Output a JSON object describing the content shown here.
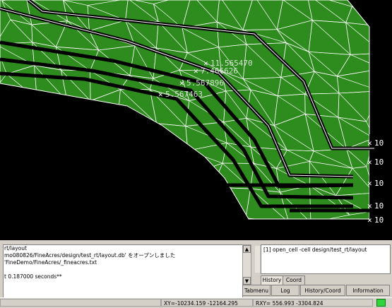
{
  "canvas": {
    "background_color": "#000000",
    "fill_color": "#2e8b1e",
    "mesh_color": "#ffffff",
    "labels": [
      "11.565470",
      "7.466626",
      "5.567896",
      "5.567463",
      "10",
      "10",
      "10",
      "10",
      "10"
    ]
  },
  "log": {
    "lines": [
      "rt/layout",
      "mo080826/FineAcres/design/test_rt/layout.db' をオープンしました",
      "'FineDemo/FineAcres/_fineacres.txt",
      "",
      "t 0.187000 seconds**"
    ]
  },
  "history": {
    "entry": "[1] open_cell -cell design/test_rt/layout",
    "tabs": [
      "History",
      "Coord"
    ]
  },
  "buttons": [
    "Tabmenu",
    "Log",
    "History/Coord",
    "Information"
  ],
  "status": {
    "xy": "XY=-10234.159 -12164.295",
    "rxy": "RXY=  556.993  -3304.824",
    "indicator_color": "#2fd53a"
  }
}
